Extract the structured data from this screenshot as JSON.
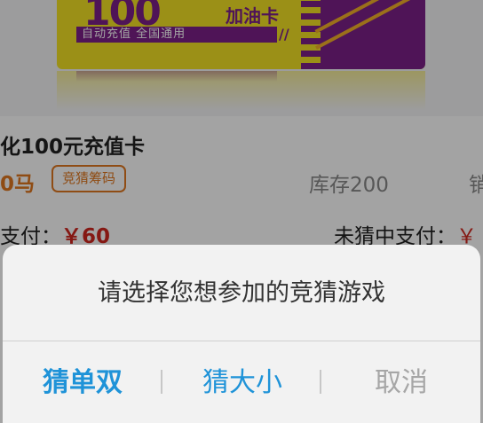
{
  "banner": {
    "card_big": "100",
    "card_text": "加油卡",
    "card_band_text": "自动充值  全国通用",
    "card_slash": "//"
  },
  "product": {
    "title": "化100元充值卡",
    "price": "0马",
    "badge": "竞猜筹码",
    "stock": "库存200",
    "stock_cut": "销",
    "pay_left_label": "支付：",
    "pay_left_amount": "￥60",
    "pay_right_label": "未猜中支付：",
    "pay_right_amount": "￥"
  },
  "dialog": {
    "title": "请选择您想参加的竞猜游戏",
    "options": [
      {
        "label": "猜单双"
      },
      {
        "label": "猜大小"
      },
      {
        "label": "取消"
      }
    ]
  },
  "colors": {
    "accent": "#1f93d8",
    "price": "#e07820",
    "amount": "#d0261f",
    "card_yellow": "#f3e225",
    "card_purple": "#7c2088"
  }
}
